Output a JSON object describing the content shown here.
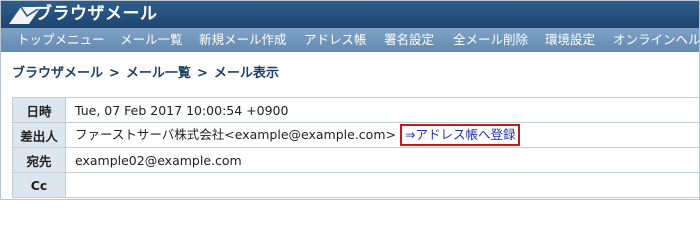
{
  "app": {
    "title": "ブラウザメール",
    "logo": "envelope-logo"
  },
  "menu": [
    {
      "label": "トップメニュー"
    },
    {
      "label": "メール一覧"
    },
    {
      "label": "新規メール作成"
    },
    {
      "label": "アドレス帳"
    },
    {
      "label": "署名設定"
    },
    {
      "label": "全メール削除"
    },
    {
      "label": "環境設定"
    },
    {
      "label": "オンラインヘルプ"
    }
  ],
  "breadcrumb": {
    "items": [
      "ブラウザメール",
      "メール一覧",
      "メール表示"
    ],
    "separator": ">"
  },
  "mail": {
    "date_label": "日時",
    "date_value": "Tue, 07 Feb 2017 10:00:54 +0900",
    "from_label": "差出人",
    "from_value": "ファーストサーバ株式会社<example@example.com>",
    "add_to_address_book": "⇒アドレス帳へ登録",
    "to_label": "宛先",
    "to_value": "example02@example.com",
    "cc_label": "Cc",
    "cc_value": ""
  },
  "colors": {
    "title_bar": "#1d4670",
    "menu_bar": "#6e93b8",
    "highlight_border": "#c0191c",
    "link": "#2233bb"
  }
}
